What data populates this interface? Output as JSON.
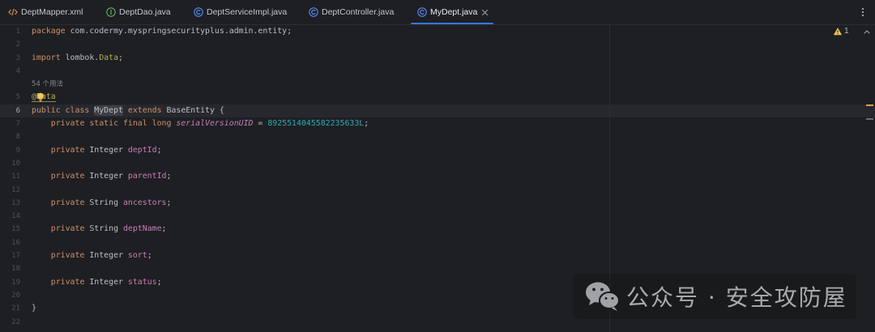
{
  "theme": {
    "background": "#1e1f22",
    "accent": "#3574f0",
    "warning": "#f2c55c"
  },
  "tabs": [
    {
      "label": "DeptMapper.xml",
      "icon": "xml-file-icon"
    },
    {
      "label": "DeptDao.java",
      "icon": "interface-file-icon"
    },
    {
      "label": "DeptServiceImpl.java",
      "icon": "class-file-icon"
    },
    {
      "label": "DeptController.java",
      "icon": "class-file-icon"
    },
    {
      "label": "MyDept.java",
      "icon": "class-file-icon",
      "active": true,
      "close_icon": "close-tab-icon"
    }
  ],
  "toolbar": {
    "more_icon": "more-vertical-icon"
  },
  "inspections": {
    "icon": "warning-icon",
    "warning_count": 1,
    "navigate_icon": "chevron-up-icon"
  },
  "editor": {
    "lines": [
      {
        "number": 1,
        "tokens": [
          {
            "text": "package",
            "color": "#cf8e6d"
          },
          {
            "text": " com.codermy.myspringsecurityplus.admin.entity;",
            "color": "#bcbec4"
          }
        ]
      },
      {
        "number": 2,
        "tokens": []
      },
      {
        "number": 3,
        "tokens": [
          {
            "text": "import",
            "color": "#cf8e6d"
          },
          {
            "text": " lombok.",
            "color": "#bcbec4"
          },
          {
            "text": "Data",
            "color": "#b3ae60"
          },
          {
            "text": ";",
            "color": "#bcbec4"
          }
        ]
      },
      {
        "number": 4,
        "tokens": []
      },
      {
        "inlay": "54 个用法"
      },
      {
        "number": 5,
        "icon": "intention-bulb-icon",
        "tokens": [
          {
            "text": "@Data",
            "color": "#b3ae60",
            "underline": true
          }
        ]
      },
      {
        "number": 6,
        "current": true,
        "tokens": [
          {
            "text": "public class ",
            "color": "#cf8e6d"
          },
          {
            "text": "MyDept",
            "color": "#bcbec4",
            "background": "#3b3e44"
          },
          {
            "text": " extends ",
            "color": "#cf8e6d"
          },
          {
            "text": "BaseEntity {",
            "color": "#bcbec4"
          }
        ]
      },
      {
        "number": 7,
        "tokens": [
          {
            "text": "    private static final long ",
            "color": "#cf8e6d"
          },
          {
            "text": "serialVersionUID",
            "color": "#c77dbb",
            "italic": true
          },
          {
            "text": " = ",
            "color": "#bcbec4"
          },
          {
            "text": "8925514045582235633L",
            "color": "#2aacb8"
          },
          {
            "text": ";",
            "color": "#bcbec4"
          }
        ]
      },
      {
        "number": 8,
        "tokens": []
      },
      {
        "number": 9,
        "tokens": [
          {
            "text": "    private ",
            "color": "#cf8e6d"
          },
          {
            "text": "Integer ",
            "color": "#bcbec4"
          },
          {
            "text": "deptId",
            "color": "#c77dbb"
          },
          {
            "text": ";",
            "color": "#bcbec4"
          }
        ]
      },
      {
        "number": 10,
        "tokens": []
      },
      {
        "number": 11,
        "tokens": [
          {
            "text": "    private ",
            "color": "#cf8e6d"
          },
          {
            "text": "Integer ",
            "color": "#bcbec4"
          },
          {
            "text": "parentId",
            "color": "#c77dbb"
          },
          {
            "text": ";",
            "color": "#bcbec4"
          }
        ]
      },
      {
        "number": 12,
        "tokens": []
      },
      {
        "number": 13,
        "tokens": [
          {
            "text": "    private ",
            "color": "#cf8e6d"
          },
          {
            "text": "String ",
            "color": "#bcbec4"
          },
          {
            "text": "ancestors",
            "color": "#c77dbb"
          },
          {
            "text": ";",
            "color": "#bcbec4"
          }
        ]
      },
      {
        "number": 14,
        "tokens": []
      },
      {
        "number": 15,
        "tokens": [
          {
            "text": "    private ",
            "color": "#cf8e6d"
          },
          {
            "text": "String ",
            "color": "#bcbec4"
          },
          {
            "text": "deptName",
            "color": "#c77dbb"
          },
          {
            "text": ";",
            "color": "#bcbec4"
          }
        ]
      },
      {
        "number": 16,
        "tokens": []
      },
      {
        "number": 17,
        "tokens": [
          {
            "text": "    private ",
            "color": "#cf8e6d"
          },
          {
            "text": "Integer ",
            "color": "#bcbec4"
          },
          {
            "text": "sort",
            "color": "#c77dbb"
          },
          {
            "text": ";",
            "color": "#bcbec4"
          }
        ]
      },
      {
        "number": 18,
        "tokens": []
      },
      {
        "number": 19,
        "tokens": [
          {
            "text": "    private ",
            "color": "#cf8e6d"
          },
          {
            "text": "Integer ",
            "color": "#bcbec4"
          },
          {
            "text": "status",
            "color": "#c77dbb"
          },
          {
            "text": ";",
            "color": "#bcbec4"
          }
        ]
      },
      {
        "number": 20,
        "tokens": []
      },
      {
        "number": 21,
        "tokens": [
          {
            "text": "}",
            "color": "#bcbec4"
          }
        ]
      },
      {
        "number": 22,
        "tokens": []
      }
    ]
  },
  "watermark": {
    "icon": "wechat-logo-icon",
    "text": "公众号 · 安全攻防屋"
  }
}
